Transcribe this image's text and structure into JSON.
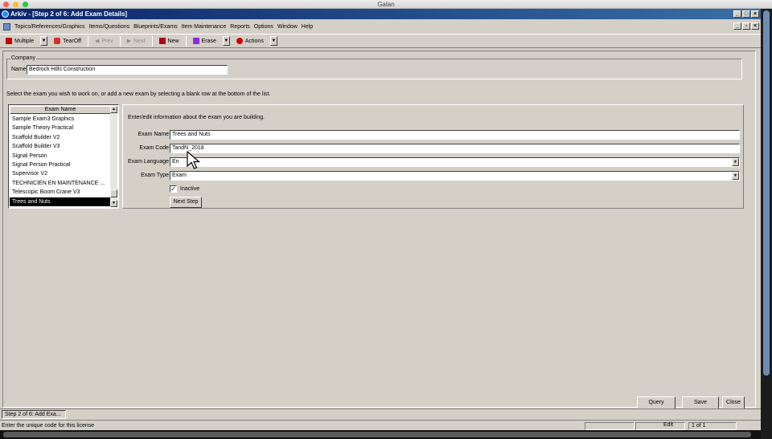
{
  "mac": {
    "title": "Galan"
  },
  "window": {
    "title": "Arkiv - [Step 2 of 6: Add Exam Details]"
  },
  "menu": [
    {
      "label": "Topics/References/Graphics"
    },
    {
      "label": "Items/Questions"
    },
    {
      "label": "Blueprints/Exams"
    },
    {
      "label": "Item Maintenance"
    },
    {
      "label": "Reports"
    },
    {
      "label": "Options"
    },
    {
      "label": "Window"
    },
    {
      "label": "Help"
    }
  ],
  "toolbar": {
    "multiple": "Multiple",
    "tearoff": "TearOff",
    "prev": "Prev",
    "next": "Next",
    "new": "New",
    "erase": "Erase",
    "actions": "Actions"
  },
  "company": {
    "legend": "Company",
    "name_label": "Name",
    "name_value": "Bedrock Hills Construction"
  },
  "instruction": "Select the exam you wish to work on, or add a new exam by selecting a blank row at the bottom of the list.",
  "exam_list": {
    "header": "Exam Name",
    "items": [
      "Sample Exam3 Graphics",
      "Sample Theory Practical",
      "Scaffold Builder V2",
      "Scaffold Builder V3",
      "Signal Person",
      "Signal Person Practical",
      "Supervisor V2",
      "TECHNICIEN EN MAINTENANCE ...",
      "Telescopic Boom Crane V3",
      "Trees and Nuts"
    ],
    "selected_index": 9
  },
  "details": {
    "instruction": "Enter/edit information about the exam you are building.",
    "exam_name_label": "Exam Name",
    "exam_name_value": "Trees and Nuts",
    "exam_code_label": "Exam Code",
    "exam_code_value": "TandN_2018",
    "exam_language_label": "Exam Language",
    "exam_language_value": "En",
    "exam_type_label": "Exam Type",
    "exam_type_value": "Exam",
    "inactive_label": "Inactive",
    "inactive_checked": "✓",
    "next_step_label": "Next Step"
  },
  "buttons": {
    "query": "Query",
    "save": "Save",
    "close": "Close"
  },
  "taskbar": {
    "tab": "Step 2 of 6: Add Exa..."
  },
  "status": {
    "text": "Enter the unique code for this license",
    "mode": "Edit",
    "record": "1 of 1"
  },
  "colors": {
    "title_start": "#0a246a",
    "title_end": "#3a6ea5",
    "chrome": "#d4d0c8",
    "selection": "#000000"
  }
}
